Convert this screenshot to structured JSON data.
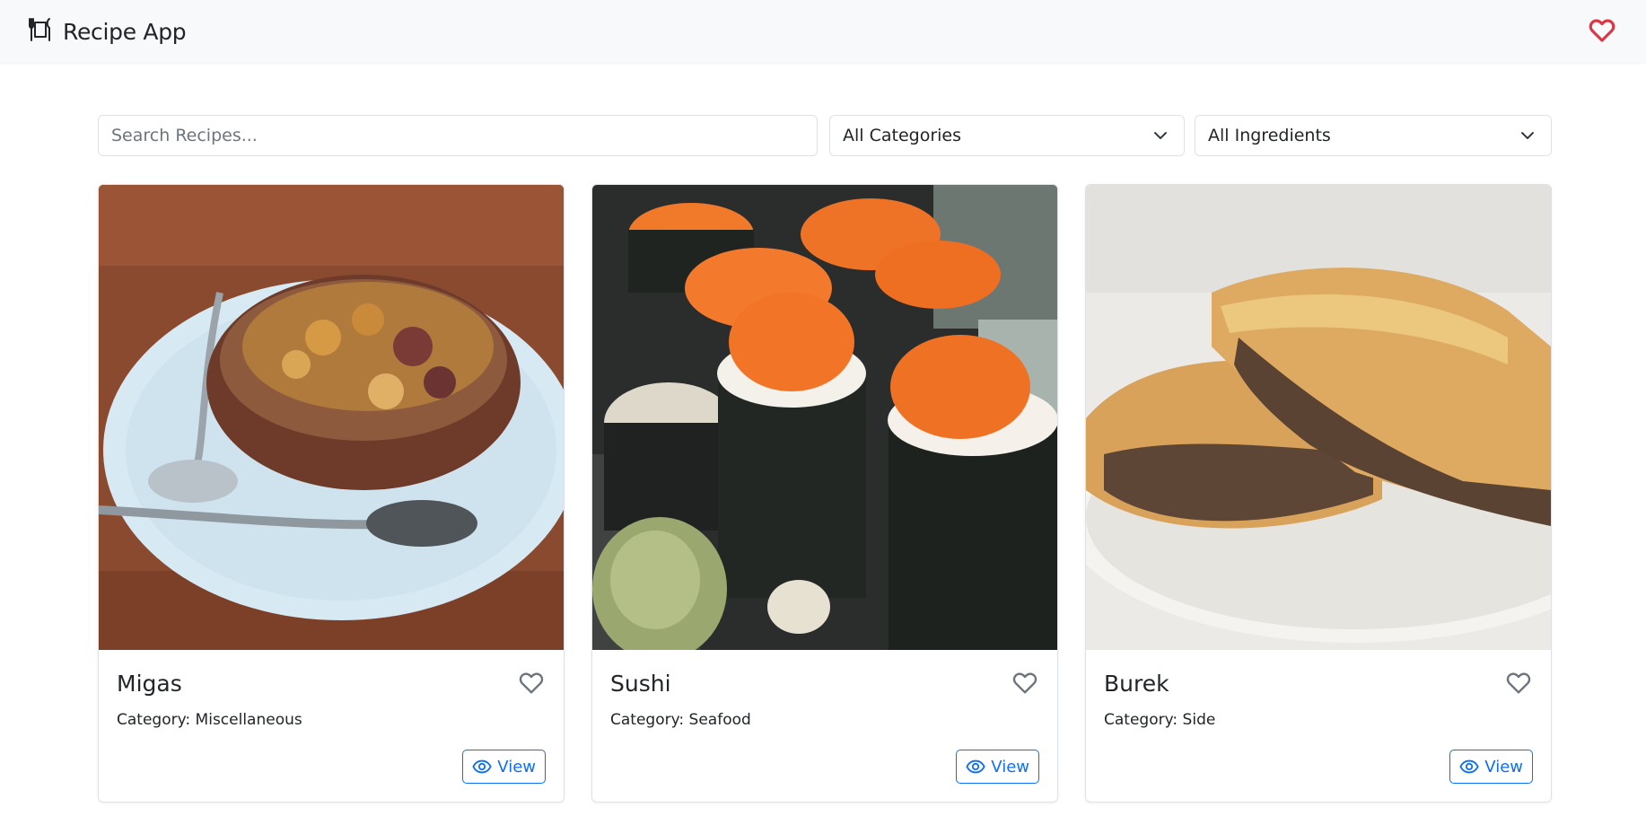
{
  "navbar": {
    "brand": "Recipe App",
    "brand_icon": "utensils-plate-icon",
    "favorites_icon": "heart-icon",
    "favorites_color": "#dc3545"
  },
  "filters": {
    "search_placeholder": "Search Recipes...",
    "search_value": "",
    "category_selected": "All Categories",
    "ingredient_selected": "All Ingredients"
  },
  "recipes": [
    {
      "title": "Migas",
      "category": "Category: Miscellaneous",
      "view_label": "View"
    },
    {
      "title": "Sushi",
      "category": "Category: Seafood",
      "view_label": "View"
    },
    {
      "title": "Burek",
      "category": "Category: Side",
      "view_label": "View"
    }
  ],
  "colors": {
    "accent": "#0d6efd",
    "navbar_bg": "#f8f9fa",
    "heart_outline": "#6c757d"
  }
}
